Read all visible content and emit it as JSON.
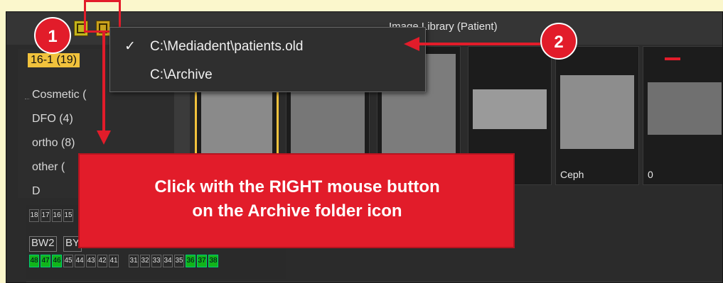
{
  "window": {
    "title": "Image Library (Patient)"
  },
  "context_menu": {
    "items": [
      {
        "label": "C:\\Mediadent\\patients.old",
        "checked": true
      },
      {
        "label": "C:\\Archive",
        "checked": false
      }
    ],
    "check_glyph": "✓"
  },
  "tree": {
    "items": [
      {
        "label": "16-1 (19)",
        "selected": true
      },
      {
        "label": "Cosmetic ("
      },
      {
        "label": "DFO (4)"
      },
      {
        "label": "ortho (8)"
      },
      {
        "label": "other ("
      },
      {
        "label": "D"
      }
    ]
  },
  "thumbnails": [
    {
      "caption": "",
      "selected": true
    },
    {
      "caption": ""
    },
    {
      "caption": ""
    },
    {
      "caption": ""
    },
    {
      "caption": "Ceph"
    },
    {
      "caption": "0"
    }
  ],
  "badges": {
    "one": "1",
    "two": "2"
  },
  "callout": {
    "line1": "Click with the RIGHT mouse button",
    "line2": "on the Archive folder icon"
  },
  "tooth_chart": {
    "top_row": [
      "18",
      "17",
      "16",
      "15"
    ],
    "bw_labels": [
      "BW2",
      "BY"
    ],
    "bottom_row": [
      "48",
      "47",
      "46",
      "45",
      "44",
      "43",
      "42",
      "41",
      "31",
      "32",
      "33",
      "34",
      "35",
      "36",
      "37",
      "38"
    ],
    "green_bottom": [
      "48",
      "47",
      "46",
      "36",
      "37",
      "38"
    ]
  },
  "colors": {
    "accent_red": "#e21c2a",
    "selection_yellow": "#f1c23c",
    "tooth_green": "#12b41a"
  }
}
